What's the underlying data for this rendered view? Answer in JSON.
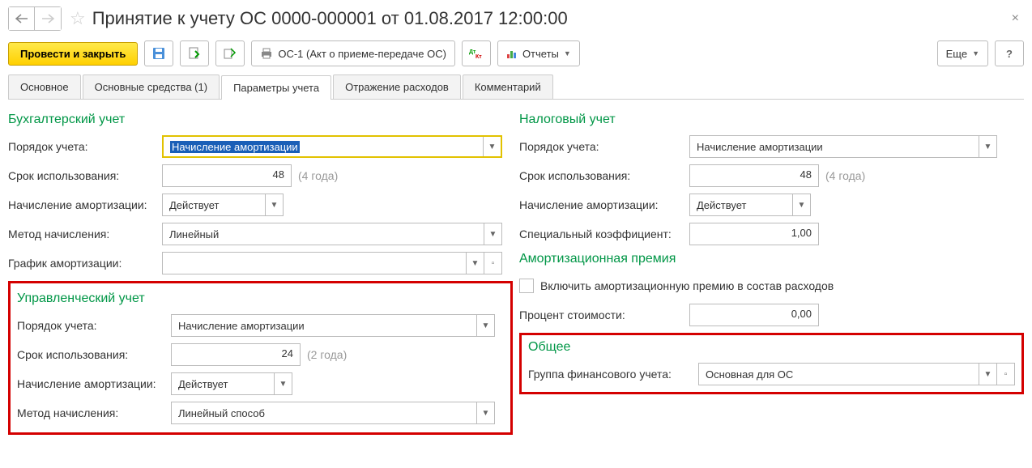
{
  "header": {
    "title": "Принятие к учету ОС 0000-000001 от 01.08.2017 12:00:00"
  },
  "toolbar": {
    "post_close": "Провести и закрыть",
    "os1": "ОС-1 (Акт о приеме-передаче ОС)",
    "reports": "Отчеты",
    "more": "Еще",
    "help": "?"
  },
  "tabs": {
    "t1": "Основное",
    "t2": "Основные средства (1)",
    "t3": "Параметры учета",
    "t4": "Отражение расходов",
    "t5": "Комментарий"
  },
  "bu": {
    "title": "Бухгалтерский учет",
    "account_order_lbl": "Порядок учета:",
    "account_order_val": "Начисление амортизации",
    "term_lbl": "Срок использования:",
    "term_val": "48",
    "term_hint": "(4 года)",
    "amort_lbl": "Начисление амортизации:",
    "amort_val": "Действует",
    "method_lbl": "Метод начисления:",
    "method_val": "Линейный",
    "schedule_lbl": "График амортизации:"
  },
  "mu": {
    "title": "Управленческий учет",
    "account_order_lbl": "Порядок учета:",
    "account_order_val": "Начисление амортизации",
    "term_lbl": "Срок использования:",
    "term_val": "24",
    "term_hint": "(2 года)",
    "amort_lbl": "Начисление амортизации:",
    "amort_val": "Действует",
    "method_lbl": "Метод начисления:",
    "method_val": "Линейный способ"
  },
  "nu": {
    "title": "Налоговый учет",
    "account_order_lbl": "Порядок учета:",
    "account_order_val": "Начисление амортизации",
    "term_lbl": "Срок использования:",
    "term_val": "48",
    "term_hint": "(4 года)",
    "amort_lbl": "Начисление амортизации:",
    "amort_val": "Действует",
    "coef_lbl": "Специальный коэффициент:",
    "coef_val": "1,00"
  },
  "ap": {
    "title": "Амортизационная премия",
    "include_lbl": "Включить амортизационную премию в состав расходов",
    "percent_lbl": "Процент стоимости:",
    "percent_val": "0,00"
  },
  "common": {
    "title": "Общее",
    "group_lbl": "Группа финансового учета:",
    "group_val": "Основная для ОС"
  }
}
